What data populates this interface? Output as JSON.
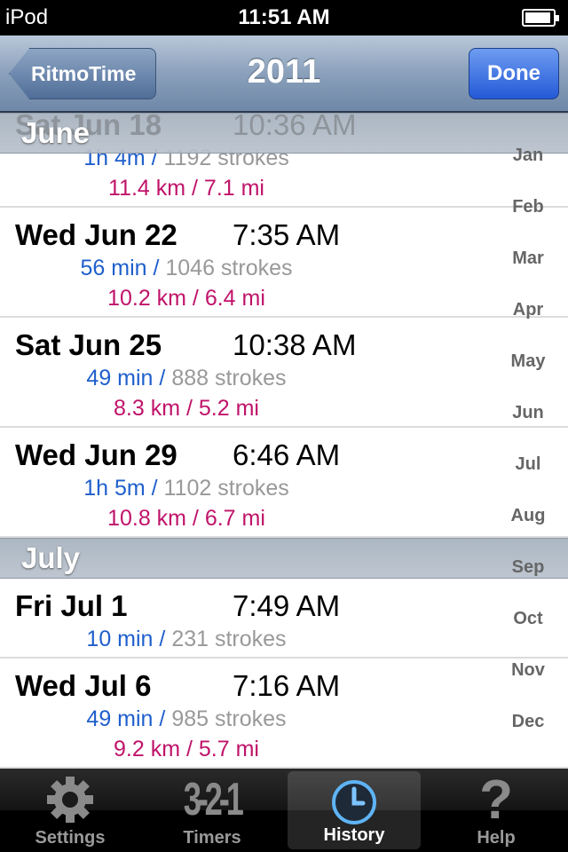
{
  "status_bar": {
    "carrier": "iPod",
    "time": "11:51 AM"
  },
  "nav": {
    "back_label": "RitmoTime",
    "title": "2011",
    "done_label": "Done"
  },
  "sections": [
    {
      "header": "June",
      "rows": [
        {
          "date": "Sat Jun 18",
          "time": "10:36 AM",
          "duration": "1h 4m /",
          "strokes": "1192 strokes",
          "distance": "11.4 km / 7.1 mi"
        },
        {
          "date": "Wed Jun 22",
          "time": "7:35 AM",
          "duration": "56 min /",
          "strokes": "1046 strokes",
          "distance": "10.2 km / 6.4 mi"
        },
        {
          "date": "Sat Jun 25",
          "time": "10:38 AM",
          "duration": "49 min /",
          "strokes": "888 strokes",
          "distance": "8.3 km / 5.2 mi"
        },
        {
          "date": "Wed Jun 29",
          "time": "6:46 AM",
          "duration": "1h 5m /",
          "strokes": "1102 strokes",
          "distance": "10.8 km / 6.7 mi"
        }
      ]
    },
    {
      "header": "July",
      "rows": [
        {
          "date": "Fri Jul 1",
          "time": "7:49 AM",
          "duration": "10 min /",
          "strokes": "231 strokes"
        },
        {
          "date": "Wed Jul 6",
          "time": "7:16 AM",
          "duration": "49 min /",
          "strokes": "985 strokes",
          "distance": "9.2 km / 5.7 mi"
        }
      ]
    }
  ],
  "index": [
    "Jan",
    "Feb",
    "Mar",
    "Apr",
    "May",
    "Jun",
    "Jul",
    "Aug",
    "Sep",
    "Oct",
    "Nov",
    "Dec"
  ],
  "tabs": [
    {
      "label": "Settings",
      "icon": "gear-icon"
    },
    {
      "label": "Timers",
      "icon": "countdown-icon",
      "glyph": "3-2-1"
    },
    {
      "label": "History",
      "icon": "clock-icon",
      "selected": true
    },
    {
      "label": "Help",
      "icon": "question-icon",
      "glyph": "?"
    }
  ]
}
